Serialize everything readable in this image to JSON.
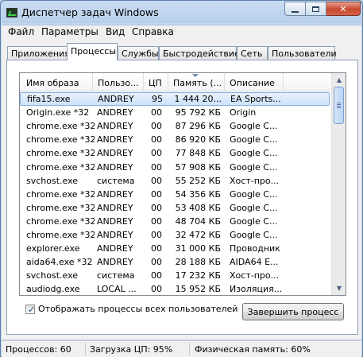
{
  "window": {
    "title": "Диспетчер задач Windows"
  },
  "menu": [
    "Файл",
    "Параметры",
    "Вид",
    "Справка"
  ],
  "tabs": [
    "Приложения",
    "Процессы",
    "Службы",
    "Быстродействие",
    "Сеть",
    "Пользователи"
  ],
  "active_tab": "Процессы",
  "columns": [
    "Имя образа",
    "Пользо...",
    "ЦП",
    "Память (...",
    "Описание"
  ],
  "sorted_column": "Память (...",
  "rows": [
    [
      "fifa15.exe",
      "ANDREY",
      "95",
      "1 444 20...",
      "EA Sports..."
    ],
    [
      "Origin.exe *32",
      "ANDREY",
      "00",
      "95 792 КБ",
      "Origin"
    ],
    [
      "chrome.exe *32",
      "ANDREY",
      "00",
      "87 296 КБ",
      "Google C..."
    ],
    [
      "chrome.exe *32",
      "ANDREY",
      "00",
      "86 920 КБ",
      "Google C..."
    ],
    [
      "chrome.exe *32",
      "ANDREY",
      "00",
      "77 848 КБ",
      "Google C..."
    ],
    [
      "chrome.exe *32",
      "ANDREY",
      "00",
      "57 908 КБ",
      "Google C..."
    ],
    [
      "svchost.exe",
      "система",
      "00",
      "55 252 КБ",
      "Хост-про..."
    ],
    [
      "chrome.exe *32",
      "ANDREY",
      "00",
      "54 356 КБ",
      "Google C..."
    ],
    [
      "chrome.exe *32",
      "ANDREY",
      "00",
      "53 408 КБ",
      "Google C..."
    ],
    [
      "chrome.exe *32",
      "ANDREY",
      "00",
      "48 704 КБ",
      "Google C..."
    ],
    [
      "chrome.exe *32",
      "ANDREY",
      "00",
      "32 472 КБ",
      "Google C..."
    ],
    [
      "explorer.exe",
      "ANDREY",
      "00",
      "31 000 КБ",
      "Проводник"
    ],
    [
      "aida64.exe *32",
      "ANDREY",
      "00",
      "28 188 КБ",
      "AIDA64 E..."
    ],
    [
      "svchost.exe",
      "система",
      "00",
      "17 232 КБ",
      "Хост-про..."
    ],
    [
      "audiodg.exe",
      "LOCAL ...",
      "00",
      "15 952 КБ",
      "Изоляция..."
    ]
  ],
  "selected_row": 0,
  "show_all_checkbox": {
    "label": "Отображать процессы всех пользователей",
    "checked": true
  },
  "end_process_button": "Завершить процесс",
  "status": {
    "processes": "Процессов: 60",
    "cpu": "Загрузка ЦП: 95%",
    "memory": "Физическая память: 60%"
  }
}
